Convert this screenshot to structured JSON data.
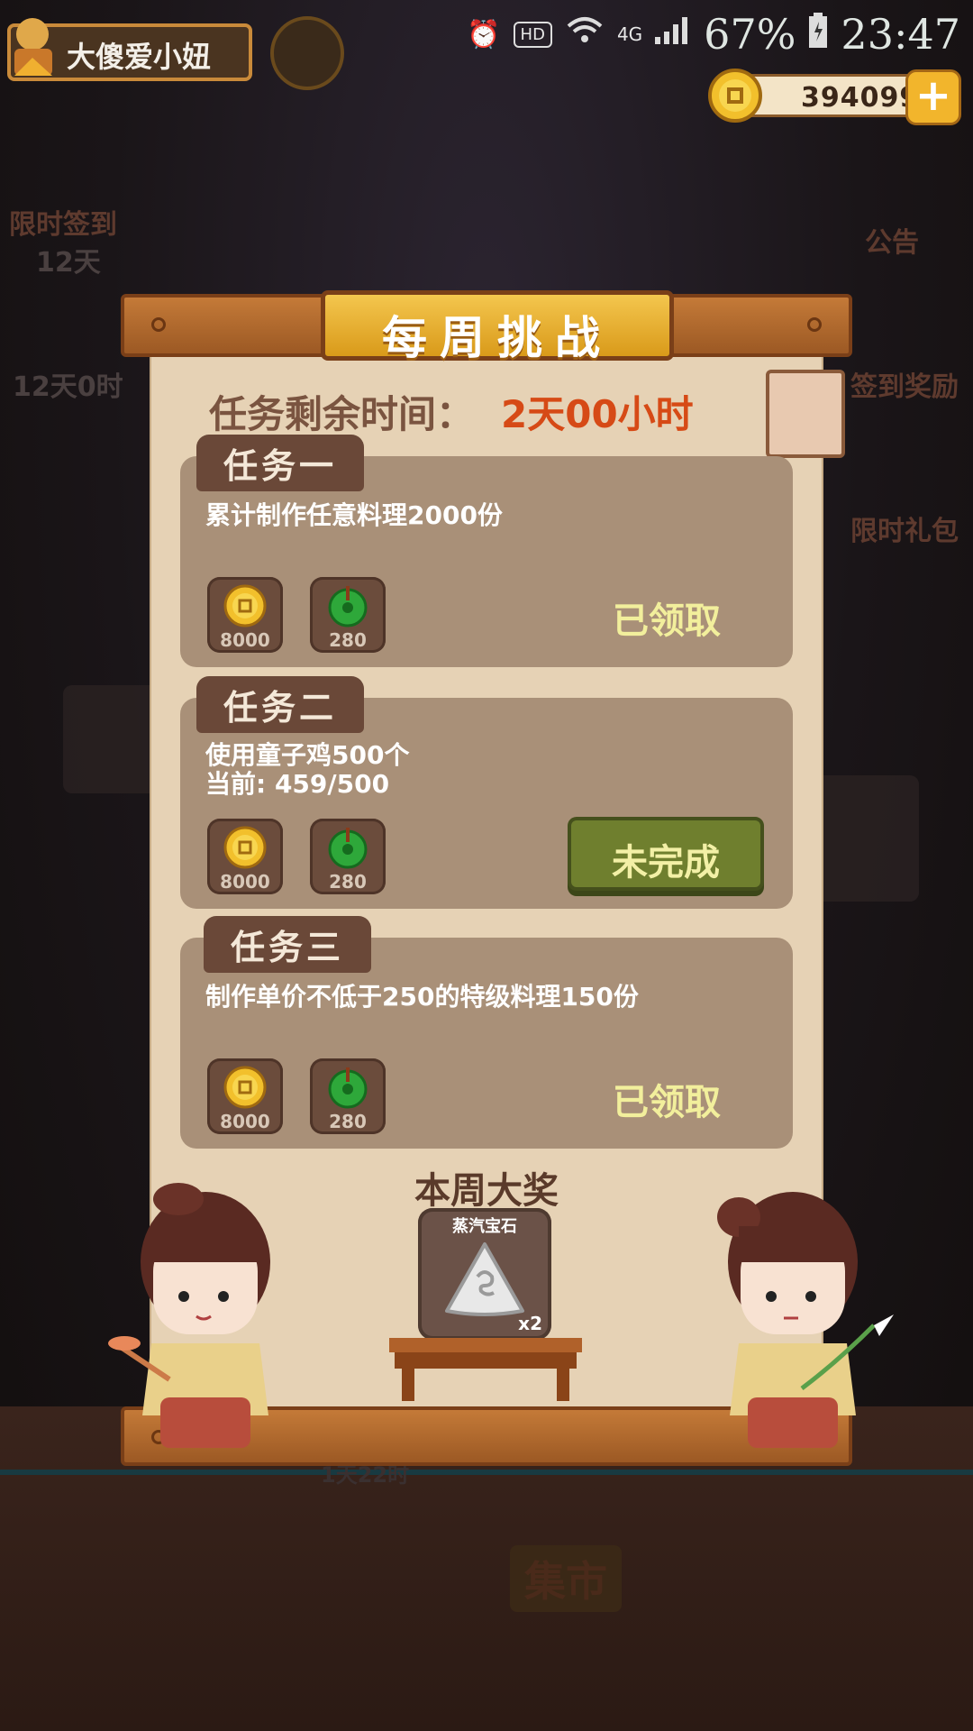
{
  "status_bar": {
    "network": "4G",
    "hd_badge": "HD",
    "battery": "67%",
    "time": "23:47"
  },
  "player": {
    "name": "大傻爱小妞",
    "coins": "394099"
  },
  "side_menu": {
    "limited_sign_in": "限时签到",
    "limited_sign_in_days": "12天",
    "left_item2_time": "12天0时",
    "announcement": "公告",
    "sign_in_reward": "签到奖励",
    "limited_gift": "限时礼包",
    "market": "集市",
    "bottom_timer": "1天22时"
  },
  "modal": {
    "title": "每周挑战",
    "remaining_label": "任务剩余时间：",
    "remaining_value": "2天00小时",
    "tasks": [
      {
        "tab": "任务一",
        "description": "累计制作任意料理2000份",
        "progress": "",
        "rewards": [
          {
            "icon": "gold-coin-icon",
            "amount": "8000"
          },
          {
            "icon": "green-jade-icon",
            "amount": "280"
          }
        ],
        "status": "已领取"
      },
      {
        "tab": "任务二",
        "description": "使用童子鸡500个",
        "progress": "当前: 459/500",
        "rewards": [
          {
            "icon": "gold-coin-icon",
            "amount": "8000"
          },
          {
            "icon": "green-jade-icon",
            "amount": "280"
          }
        ],
        "status": "未完成"
      },
      {
        "tab": "任务三",
        "description": "制作单价不低于250的特级料理150份",
        "progress": "",
        "rewards": [
          {
            "icon": "gold-coin-icon",
            "amount": "8000"
          },
          {
            "icon": "green-jade-icon",
            "amount": "280"
          }
        ],
        "status": "已领取"
      }
    ],
    "grand_prize": {
      "title": "本周大奖",
      "item_name": "蒸汽宝石",
      "quantity": "x2",
      "icon": "steam-gem-icon"
    }
  },
  "colors": {
    "accent_orange": "#d64a16",
    "panel": "#e6d2b5",
    "card": "#a99078",
    "button_green": "#6f7f2e",
    "claimed_text": "#f2ef9c"
  }
}
